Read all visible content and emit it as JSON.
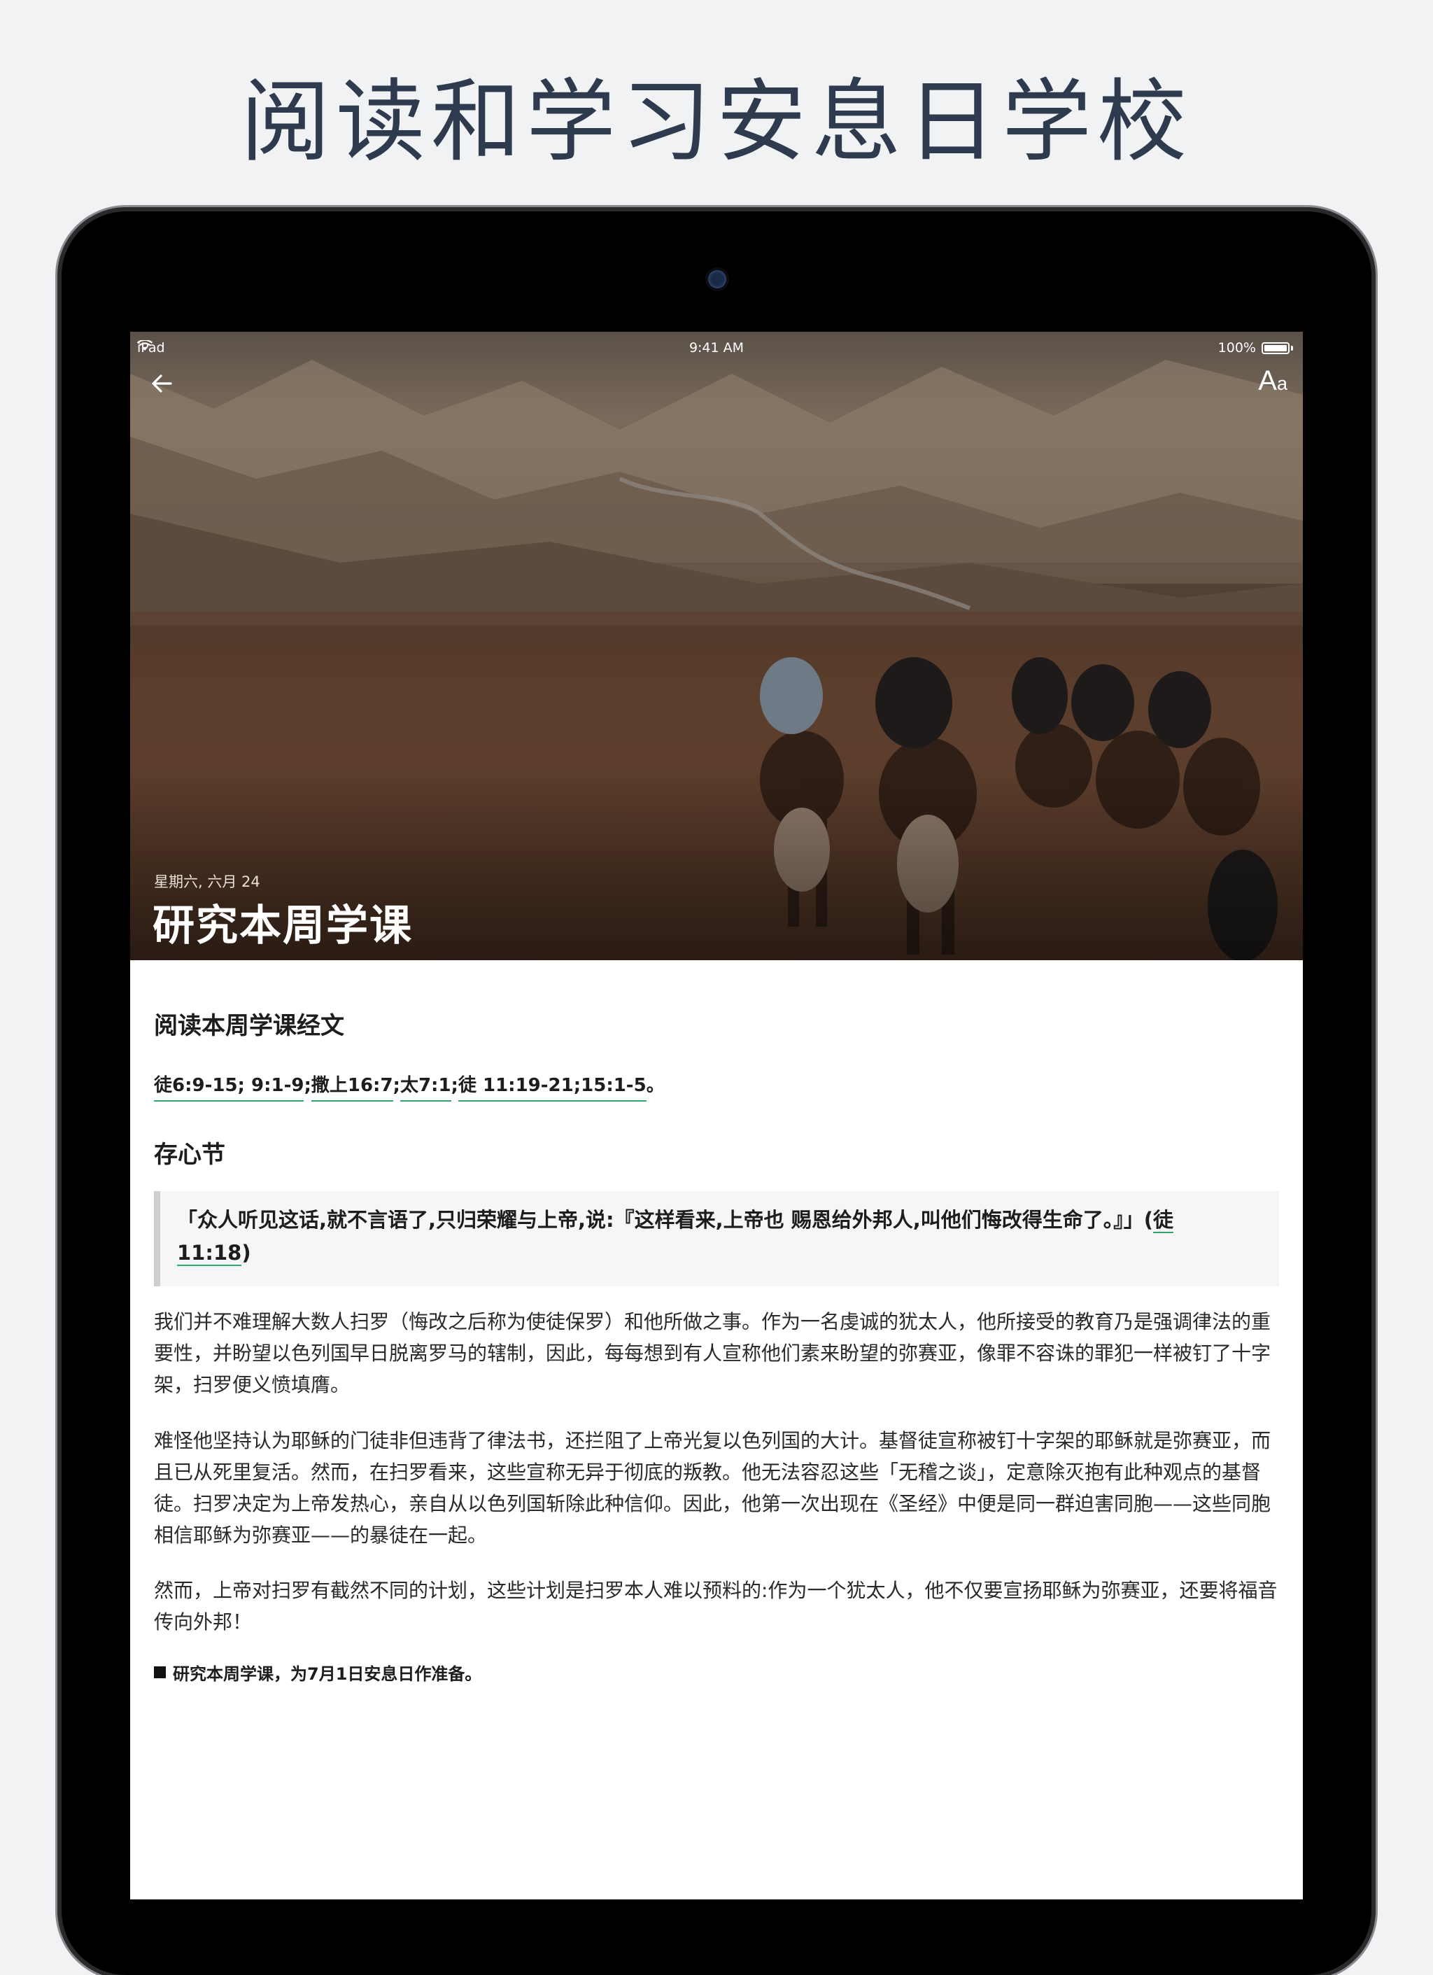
{
  "headline": "阅读和学习安息日学校",
  "status_bar": {
    "device": "iPad",
    "time": "9:41 AM",
    "battery": "100%"
  },
  "header": {
    "back_icon": "arrow-left-icon",
    "font_button_big": "A",
    "font_button_small": "a"
  },
  "hero": {
    "date": "星期六, 六月 24",
    "title": "研究本周学课"
  },
  "lesson": {
    "reading_heading": "阅读本周学课经文",
    "references": [
      "徒6:9-15; 9:1-9",
      "撒上16:7",
      "太7:1",
      "徒 11:19-21;15:1-5"
    ],
    "references_end": "。",
    "memory_heading": "存心节",
    "memory_text": "「众人听见这话,就不言语了,只归荣耀与上帝,说:『这样看来,上帝也 赐恩给外邦人,叫他们悔改得生命了。』」(",
    "memory_ref_a": "徒",
    "memory_ref_b": "11:18",
    "memory_end": ")",
    "paragraphs": [
      "我们并不难理解大数人扫罗（悔改之后称为使徒保罗）和他所做之事。作为一名虔诚的犹太人，他所接受的教育乃是强调律法的重要性，并盼望以色列国早日脱离罗马的辖制，因此，每每想到有人宣称他们素来盼望的弥赛亚，像罪不容诛的罪犯一样被钉了十字架，扫罗便义愤填膺。",
      "难怪他坚持认为耶稣的门徒非但违背了律法书，还拦阻了上帝光复以色列国的大计。基督徒宣称被钉十字架的耶稣就是弥赛亚，而且已从死里复活。然而，在扫罗看来，这些宣称无异于彻底的叛教。他无法容忍这些「无稽之谈」，定意除灭抱有此种观点的基督徒。扫罗决定为上帝发热心，亲自从以色列国斩除此种信仰。因此，他第一次出现在《圣经》中便是同一群迫害同胞——这些同胞相信耶稣为弥赛亚——的暴徒在一起。",
      "然而，上帝对扫罗有截然不同的计划，这些计划是扫罗本人难以预料的:作为一个犹太人，他不仅要宣扬耶稣为弥赛亚，还要将福音传向外邦！"
    ],
    "note": "研究本周学课，为7月1日安息日作准备。"
  }
}
